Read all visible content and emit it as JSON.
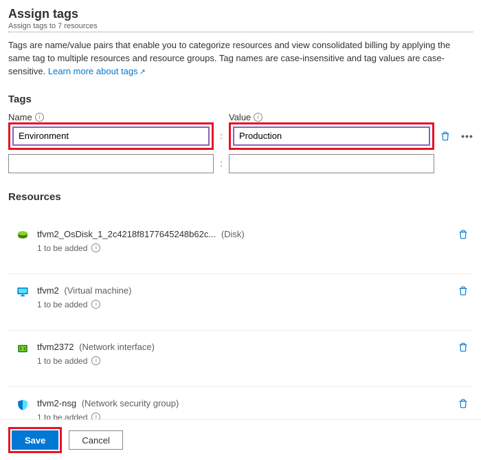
{
  "header": {
    "title": "Assign tags",
    "subtitle": "Assign tags to 7 resources"
  },
  "description": {
    "text": "Tags are name/value pairs that enable you to categorize resources and view consolidated billing by applying the same tag to multiple resources and resource groups. Tag names are case-insensitive and tag values are case-sensitive. ",
    "link_text": "Learn more about tags"
  },
  "tags": {
    "section_title": "Tags",
    "name_label": "Name",
    "value_label": "Value",
    "rows": [
      {
        "name": "Environment",
        "value": "Production"
      },
      {
        "name": "",
        "value": ""
      }
    ]
  },
  "resources": {
    "section_title": "Resources",
    "status_text": "1 to be added",
    "items": [
      {
        "name": "tfvm2_OsDisk_1_2c4218f8177645248b62c...",
        "type": "(Disk)",
        "icon": "disk"
      },
      {
        "name": "tfvm2",
        "type": "(Virtual machine)",
        "icon": "vm"
      },
      {
        "name": "tfvm2372",
        "type": "(Network interface)",
        "icon": "nic"
      },
      {
        "name": "tfvm2-nsg",
        "type": "(Network security group)",
        "icon": "nsg"
      }
    ]
  },
  "footer": {
    "save_label": "Save",
    "cancel_label": "Cancel"
  }
}
